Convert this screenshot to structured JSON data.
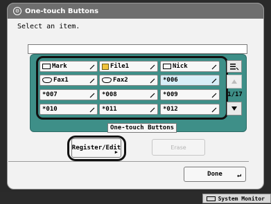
{
  "window": {
    "title": "One-touch Buttons"
  },
  "instruction": "Select an item.",
  "buttons": [
    {
      "label": "Mark",
      "icon": "mark-icon"
    },
    {
      "label": "File1",
      "icon": "file-icon"
    },
    {
      "label": "Nick",
      "icon": "mark-icon"
    },
    {
      "label": "Fax1",
      "icon": "fax-icon"
    },
    {
      "label": "Fax2",
      "icon": "fax-icon"
    },
    {
      "label": "*006",
      "icon": ""
    },
    {
      "label": "*007",
      "icon": ""
    },
    {
      "label": "*008",
      "icon": ""
    },
    {
      "label": "*009",
      "icon": ""
    },
    {
      "label": "*010",
      "icon": ""
    },
    {
      "label": "*011",
      "icon": ""
    },
    {
      "label": "*012",
      "icon": ""
    }
  ],
  "page_indicator": "1/17",
  "tab_label": "One-touch Buttons",
  "actions": {
    "register_edit": "Register/Edit",
    "erase": "Erase",
    "done": "Done"
  },
  "status_bar": {
    "system_monitor": "System Monitor"
  },
  "colors": {
    "panel": "#3e8f88",
    "title_bar": "#6e6e6e",
    "selected": "#d8eef7"
  }
}
